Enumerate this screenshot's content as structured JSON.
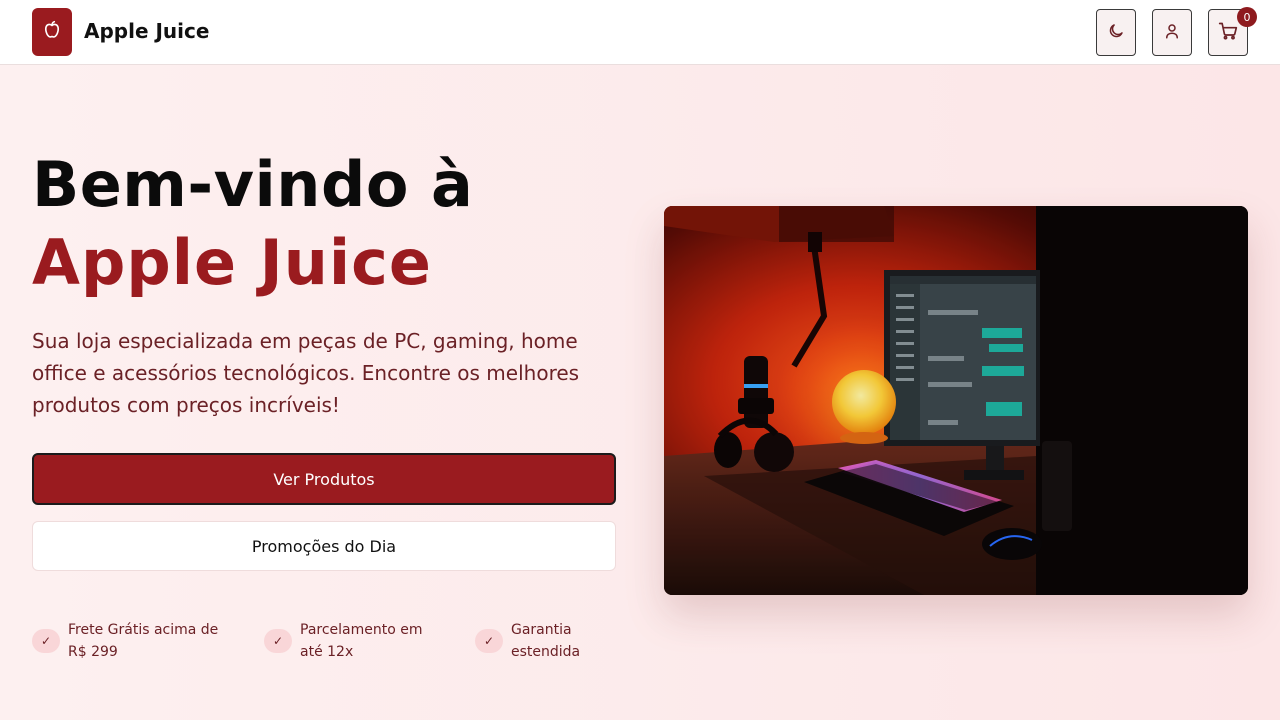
{
  "header": {
    "brand": "Apple Juice",
    "cart_count": "0",
    "icons": {
      "logo": "apple-icon",
      "theme": "moon-icon",
      "user": "user-icon",
      "cart": "cart-icon"
    }
  },
  "hero": {
    "title_line1": "Bem-vindo à",
    "title_line2": "Apple Juice",
    "subtitle": "Sua loja especializada em peças de PC, gaming, home office e acessórios tecnológicos. Encontre os melhores produtos com preços incríveis!",
    "primary_button": "Ver Produtos",
    "secondary_button": "Promoções do Dia"
  },
  "features": [
    {
      "icon": "check-icon",
      "text": "Frete Grátis acima de R$ 299"
    },
    {
      "icon": "check-icon",
      "text": "Parcelamento em até 12x"
    },
    {
      "icon": "check-icon",
      "text": "Garantia estendida"
    }
  ],
  "colors": {
    "brand": "#9a1b1f",
    "background": "#fdf0f0",
    "text_muted": "#6b2126"
  }
}
